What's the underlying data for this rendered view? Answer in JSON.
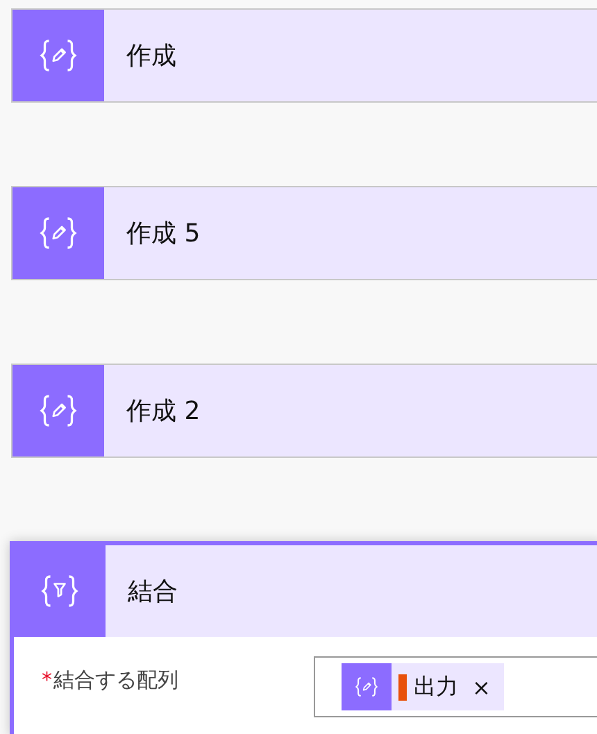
{
  "actions": [
    {
      "kind": "compose",
      "title": "作成",
      "selected": false
    },
    {
      "kind": "compose",
      "title": "作成 5",
      "selected": false
    },
    {
      "kind": "compose",
      "title": "作成 2",
      "selected": false
    },
    {
      "kind": "filter",
      "title": "結合",
      "selected": true,
      "fields": [
        {
          "label": "結合する配列",
          "required_mark": "*",
          "tokens": [
            {
              "kind": "compose",
              "label": "出力",
              "remove": "×"
            }
          ]
        }
      ]
    }
  ]
}
